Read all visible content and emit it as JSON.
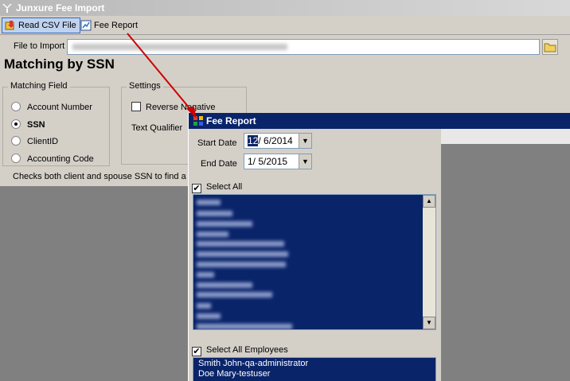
{
  "window": {
    "title": "Junxure Fee Import"
  },
  "toolbar": {
    "read_csv": "Read CSV File",
    "fee_report": "Fee Report"
  },
  "file": {
    "label": "File to Import"
  },
  "heading": "Matching by SSN",
  "matching": {
    "title": "Matching Field",
    "options": [
      "Account Number",
      "SSN",
      "ClientID",
      "Accounting Code"
    ],
    "selected": "SSN"
  },
  "settings": {
    "title": "Settings",
    "reverse_label": "Reverse Negative",
    "qualifier_label": "Text Qualifier"
  },
  "status": "Checks both client and spouse SSN to find a m",
  "dialog": {
    "title": "Fee Report",
    "start_label": "Start Date",
    "start_date": "12/ 6/2014",
    "end_label": "End Date",
    "end_date": "1/ 5/2015",
    "select_all": "Select All",
    "select_all_employees": "Select All Employees",
    "employees": [
      "Smith John-qa-administrator",
      "Doe Mary-testuser"
    ]
  },
  "colors": {
    "selection": "#0a246a",
    "panel": "#d4d0c8",
    "arrow": "#cc0000"
  }
}
